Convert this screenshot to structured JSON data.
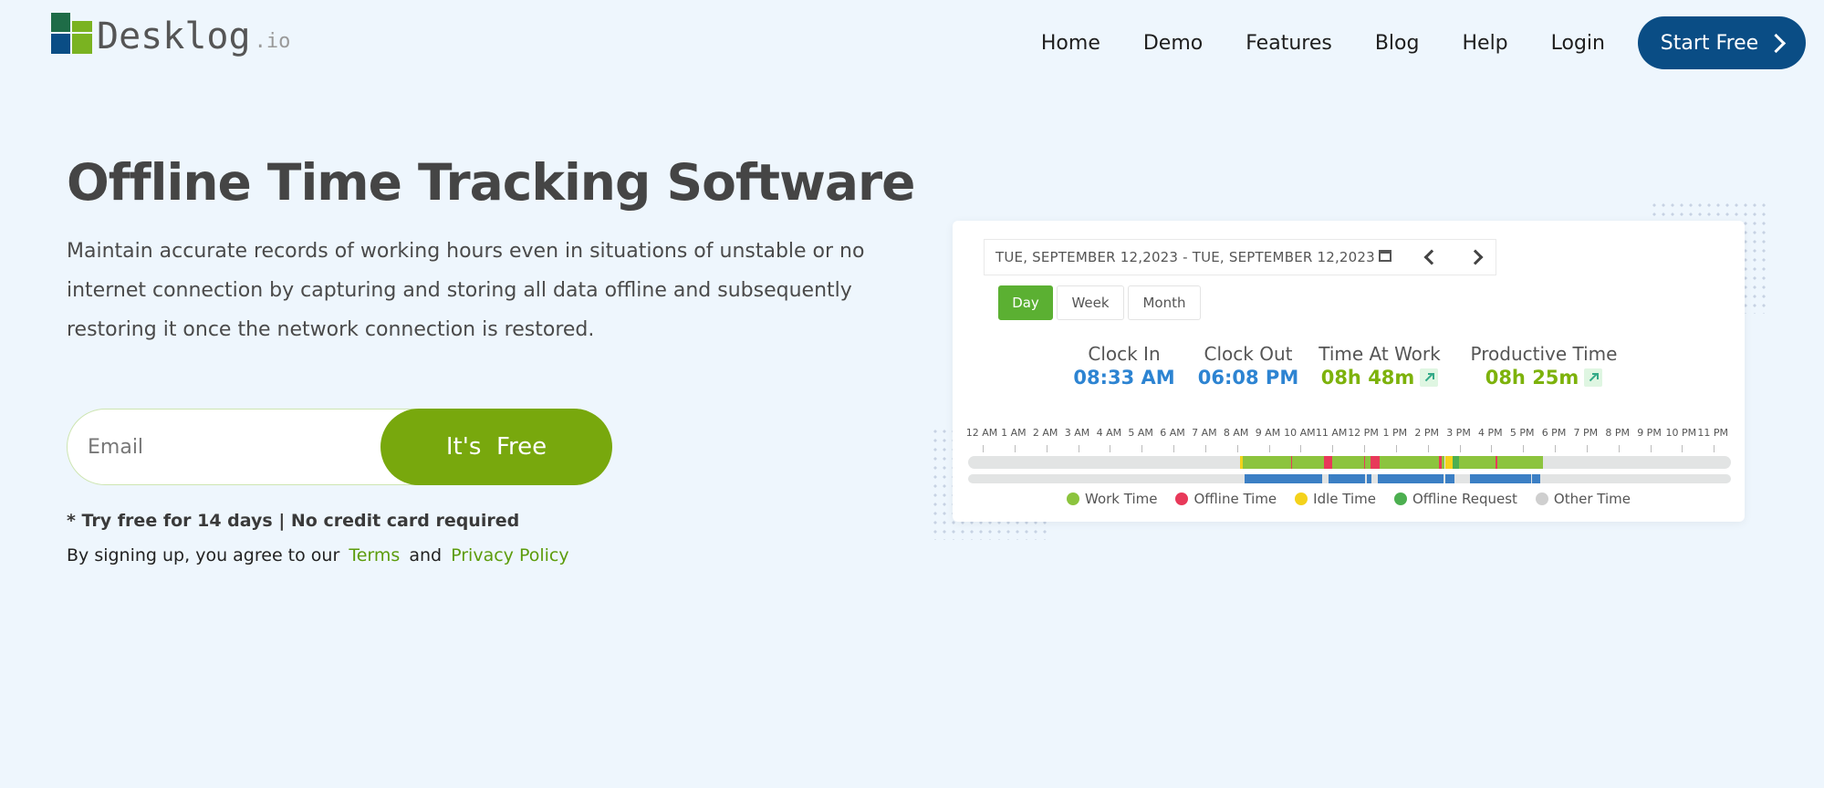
{
  "brand": {
    "name": "Desklog",
    "suffix": ".io"
  },
  "nav": {
    "items": [
      "Home",
      "Demo",
      "Features",
      "Blog",
      "Help",
      "Login"
    ],
    "cta": "Start Free"
  },
  "hero": {
    "title": "Offline Time Tracking Software",
    "description": "Maintain accurate records of working hours even in situations of unstable or no internet connection by capturing and storing all data offline and subsequently restoring it once the network connection is restored.",
    "email_placeholder": "Email",
    "cta": "It's  Free",
    "note": "* Try free for 14 days | No credit card required",
    "terms_prefix": "By signing up, you agree to our",
    "terms_link": "Terms",
    "terms_and": "and",
    "privacy_link": "Privacy Policy"
  },
  "dashboard": {
    "date_range": "TUE, SEPTEMBER 12,2023 - TUE, SEPTEMBER 12,2023",
    "tabs": [
      "Day",
      "Week",
      "Month"
    ],
    "active_tab": "Day",
    "stats": [
      {
        "label": "Clock In",
        "value": "08:33 AM",
        "color": "blue",
        "trend": false
      },
      {
        "label": "Clock Out",
        "value": "06:08 PM",
        "color": "blue",
        "trend": false
      },
      {
        "label": "Time At Work",
        "value": "08h 48m",
        "color": "green",
        "trend": true
      },
      {
        "label": "Productive Time",
        "value": "08h 25m",
        "color": "green",
        "trend": true
      }
    ],
    "hours": [
      "12 AM",
      "1 AM",
      "2 AM",
      "3 AM",
      "4 AM",
      "5 AM",
      "6 AM",
      "7 AM",
      "8 AM",
      "9 AM",
      "10 AM",
      "11 AM",
      "12 PM",
      "1 PM",
      "2 PM",
      "3 PM",
      "4 PM",
      "5 PM",
      "6 PM",
      "7 PM",
      "8 PM",
      "9 PM",
      "10 PM",
      "11 PM"
    ],
    "legend": [
      {
        "label": "Work Time",
        "color": "#8cc43e"
      },
      {
        "label": "Offline Time",
        "color": "#e8395a"
      },
      {
        "label": "Idle Time",
        "color": "#f4d21b"
      },
      {
        "label": "Offline Request",
        "color": "#4caf50"
      },
      {
        "label": "Other Time",
        "color": "#cfcfcf"
      }
    ],
    "activity_segments": [
      {
        "type": "Idle Time",
        "start_hour": 8.55,
        "end_hour": 8.65
      },
      {
        "type": "Work Time",
        "start_hour": 8.65,
        "end_hour": 10.15
      },
      {
        "type": "Offline Time",
        "start_hour": 10.15,
        "end_hour": 10.2
      },
      {
        "type": "Work Time",
        "start_hour": 10.2,
        "end_hour": 11.2
      },
      {
        "type": "Offline Time",
        "start_hour": 11.2,
        "end_hour": 11.45
      },
      {
        "type": "Work Time",
        "start_hour": 11.45,
        "end_hour": 12.45
      },
      {
        "type": "Offline Time",
        "start_hour": 12.45,
        "end_hour": 12.5
      },
      {
        "type": "Work Time",
        "start_hour": 12.5,
        "end_hour": 12.65
      },
      {
        "type": "Offline Time",
        "start_hour": 12.65,
        "end_hour": 12.95
      },
      {
        "type": "Work Time",
        "start_hour": 12.95,
        "end_hour": 14.8
      },
      {
        "type": "Offline Time",
        "start_hour": 14.8,
        "end_hour": 14.9
      },
      {
        "type": "Work Time",
        "start_hour": 14.9,
        "end_hour": 15.0
      },
      {
        "type": "Idle Time",
        "start_hour": 15.0,
        "end_hour": 15.25
      },
      {
        "type": "Offline Request",
        "start_hour": 15.25,
        "end_hour": 15.45
      },
      {
        "type": "Work Time",
        "start_hour": 15.45,
        "end_hour": 16.6
      },
      {
        "type": "Offline Time",
        "start_hour": 16.6,
        "end_hour": 16.65
      },
      {
        "type": "Work Time",
        "start_hour": 16.65,
        "end_hour": 18.1
      }
    ],
    "app_segments": [
      {
        "start_hour": 8.7,
        "end_hour": 11.15
      },
      {
        "start_hour": 11.35,
        "end_hour": 12.5
      },
      {
        "start_hour": 12.55,
        "end_hour": 12.7
      },
      {
        "start_hour": 12.9,
        "end_hour": 14.95
      },
      {
        "start_hour": 15.0,
        "end_hour": 15.3
      },
      {
        "start_hour": 15.8,
        "end_hour": 17.7
      },
      {
        "start_hour": 17.75,
        "end_hour": 18.0
      }
    ],
    "app_color": "#3b7fc4"
  }
}
